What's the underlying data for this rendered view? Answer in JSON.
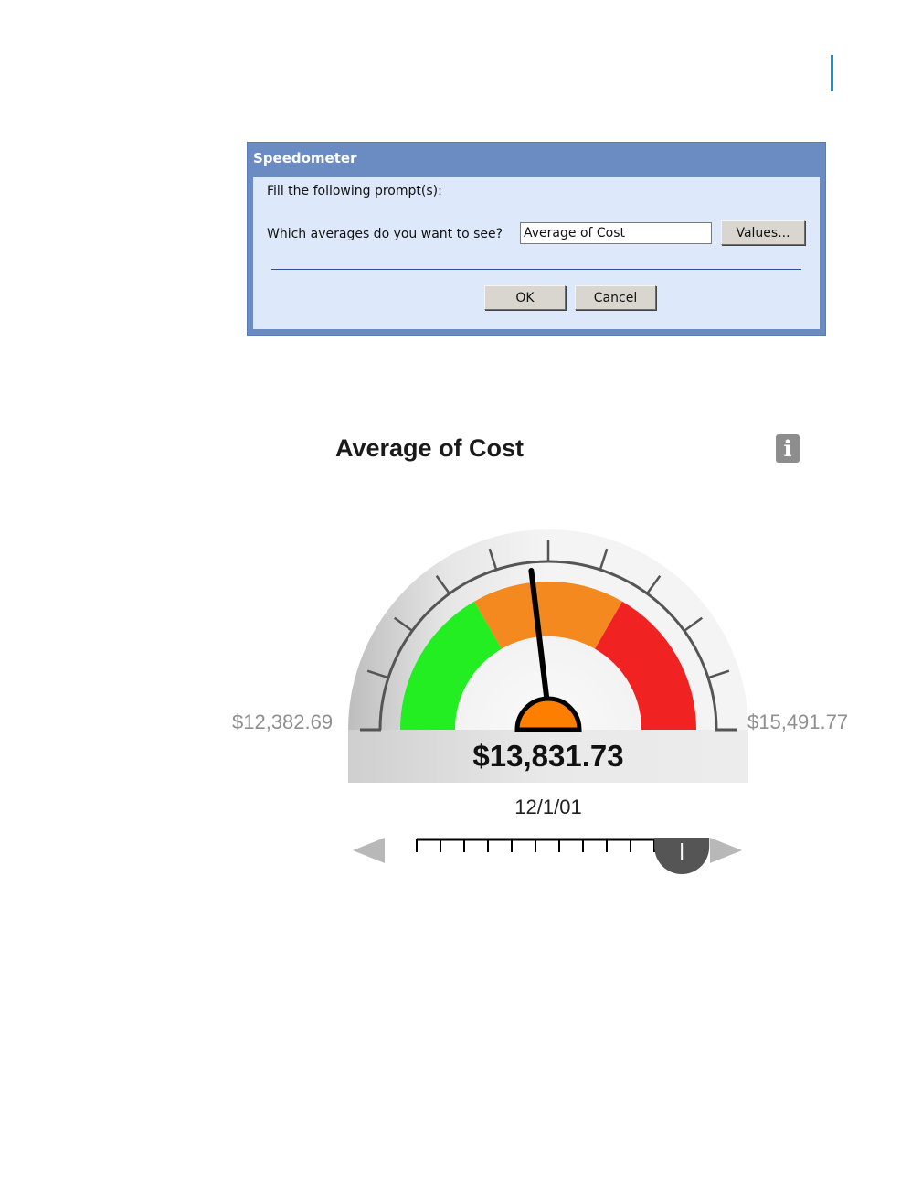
{
  "dialog": {
    "title": "Speedometer",
    "prompt_header": "Fill the following prompt(s):",
    "question": "Which averages do you want to see?",
    "input_value": "Average of Cost",
    "values_button": "Values...",
    "ok_button": "OK",
    "cancel_button": "Cancel"
  },
  "gauge": {
    "title": "Average of Cost",
    "info_icon": "info-icon",
    "min_label": "$12,382.69",
    "max_label": "$15,491.77",
    "current_label": "$13,831.73",
    "date_label": "12/1/01",
    "min": 12382.69,
    "max": 15491.77,
    "value": 13831.73,
    "bands": [
      {
        "from": 0.0,
        "to": 0.3333,
        "color": "#22ee22"
      },
      {
        "from": 0.3333,
        "to": 0.6667,
        "color": "#f48a1f"
      },
      {
        "from": 0.6667,
        "to": 1.0,
        "color": "#f02222"
      }
    ],
    "needle_color": "#000000",
    "hub_color": "#fe7e00",
    "slider_position": 0.93,
    "slider_tick_count": 13
  }
}
